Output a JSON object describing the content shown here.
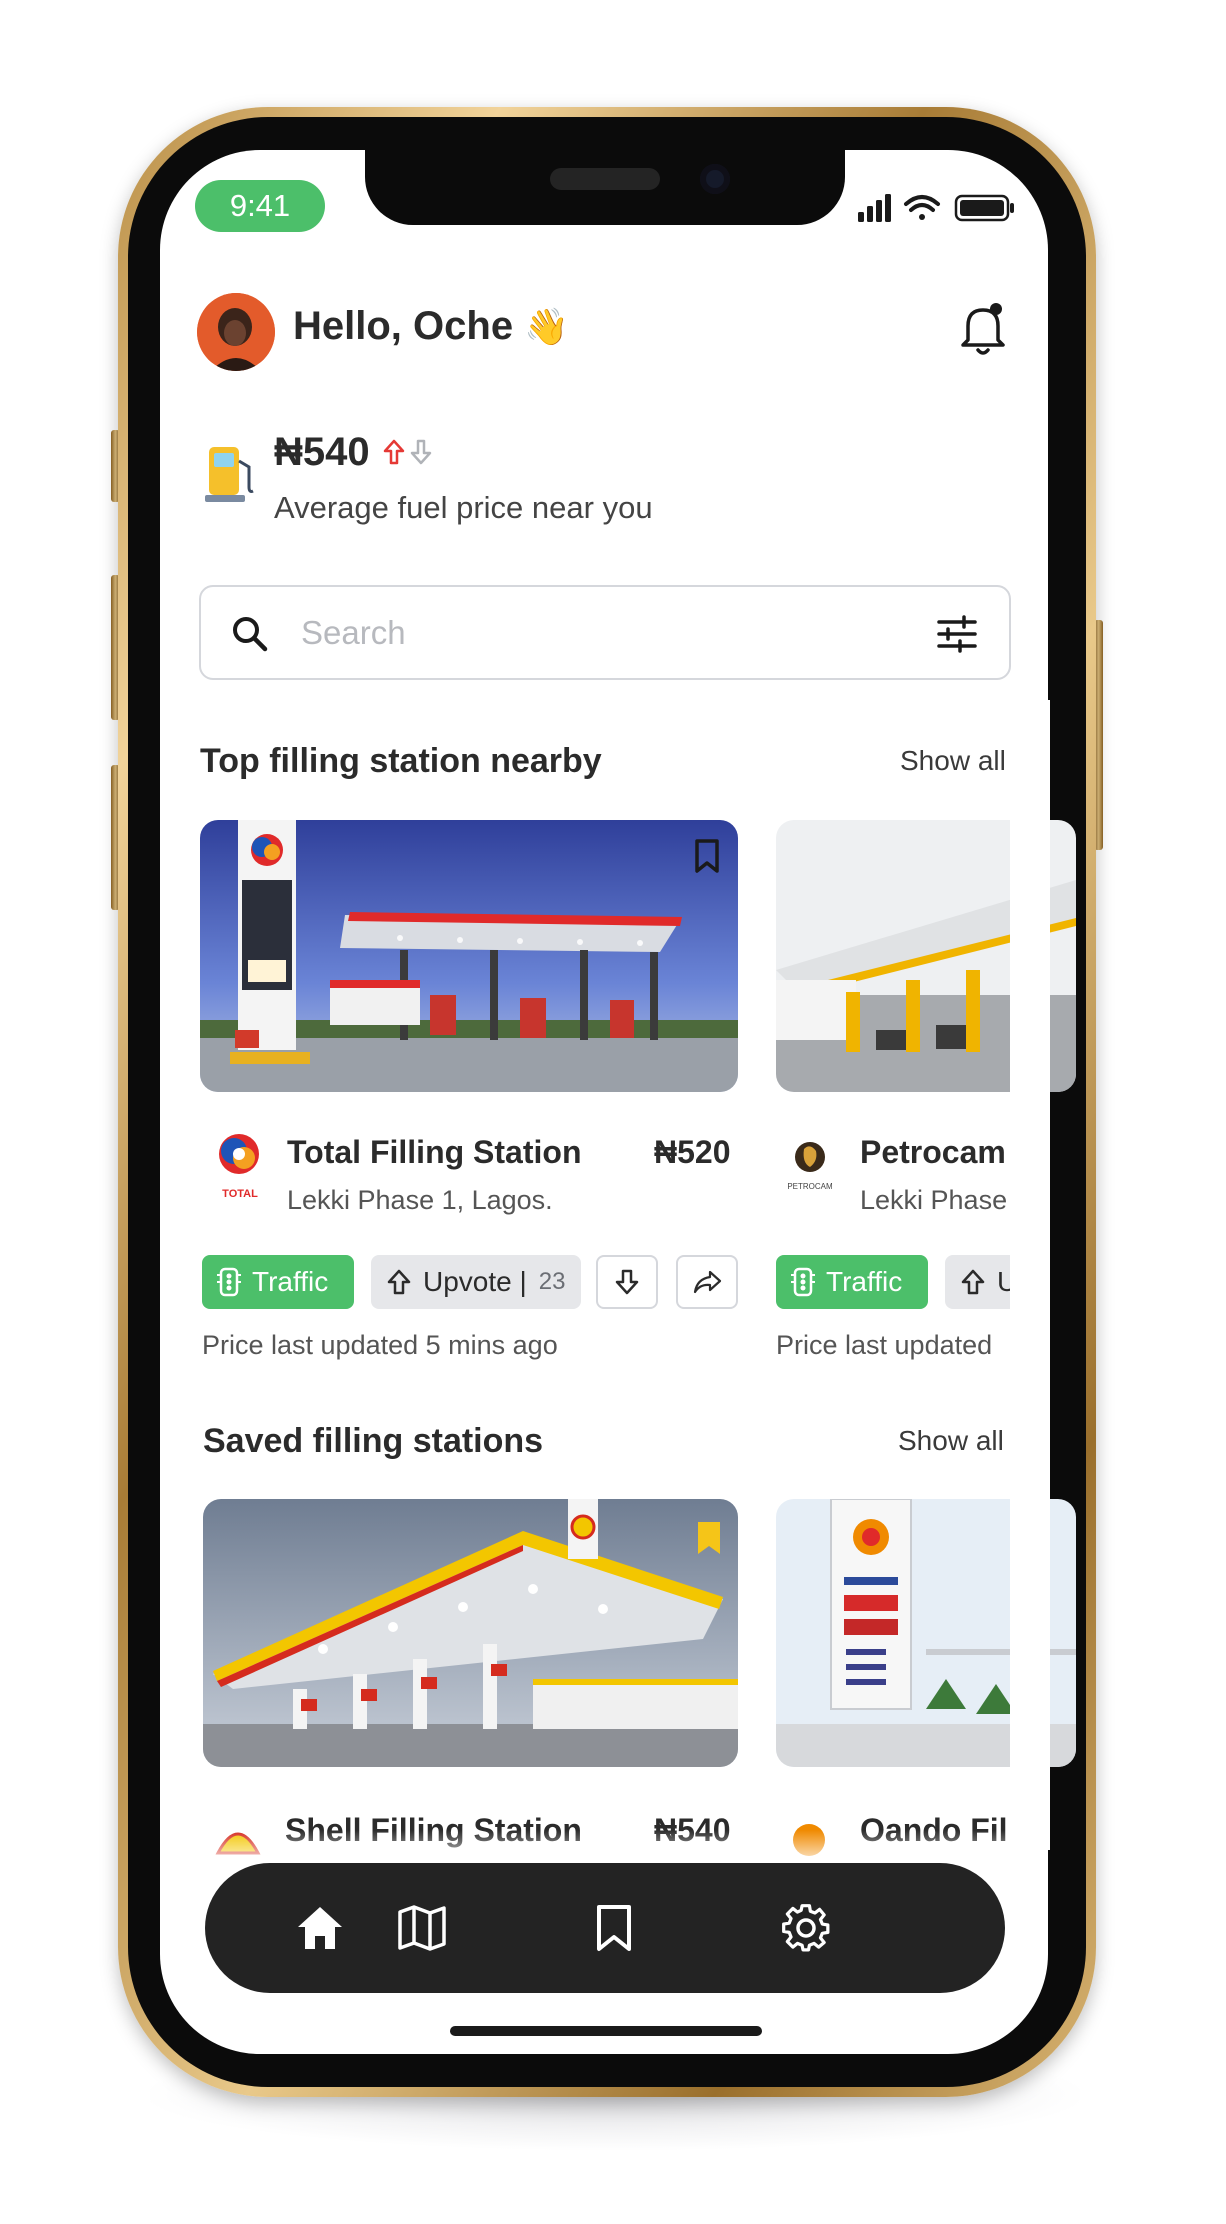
{
  "status_bar": {
    "time": "9:41"
  },
  "header": {
    "greeting": "Hello, Oche",
    "wave_emoji": "👋"
  },
  "fuel_price": {
    "amount": "₦540",
    "label": "Average fuel price near you",
    "trend_up_color": "#e53935",
    "trend_down_color": "#b0b3b8"
  },
  "search": {
    "placeholder": "Search"
  },
  "sections": {
    "top": {
      "title": "Top filling station nearby",
      "show_all": "Show all"
    },
    "saved": {
      "title": "Saved filling stations",
      "show_all": "Show all"
    }
  },
  "top_stations": [
    {
      "name": "Total Filling Station",
      "price": "₦520",
      "address": "Lekki Phase 1, Lagos.",
      "logo_text": "TOTAL",
      "traffic_label": "Traffic",
      "upvote_label": "Upvote |",
      "upvote_count": "23",
      "updated": "Price last updated 5 mins ago"
    },
    {
      "name": "Petrocam",
      "address": "Lekki Phase",
      "logo_text": "PETROCAM",
      "traffic_label": "Traffic",
      "upvote_label": "U",
      "updated": "Price last updated"
    }
  ],
  "saved_stations": [
    {
      "name": "Shell Filling Station",
      "price": "₦540"
    },
    {
      "name": "Oando Fil"
    }
  ],
  "colors": {
    "accent_green": "#4cbf6a",
    "nav_bg": "#232323",
    "saved_bookmark": "#f5c518"
  },
  "icons": {
    "nav": [
      "home-icon",
      "map-icon",
      "bookmark-icon",
      "settings-icon"
    ]
  }
}
